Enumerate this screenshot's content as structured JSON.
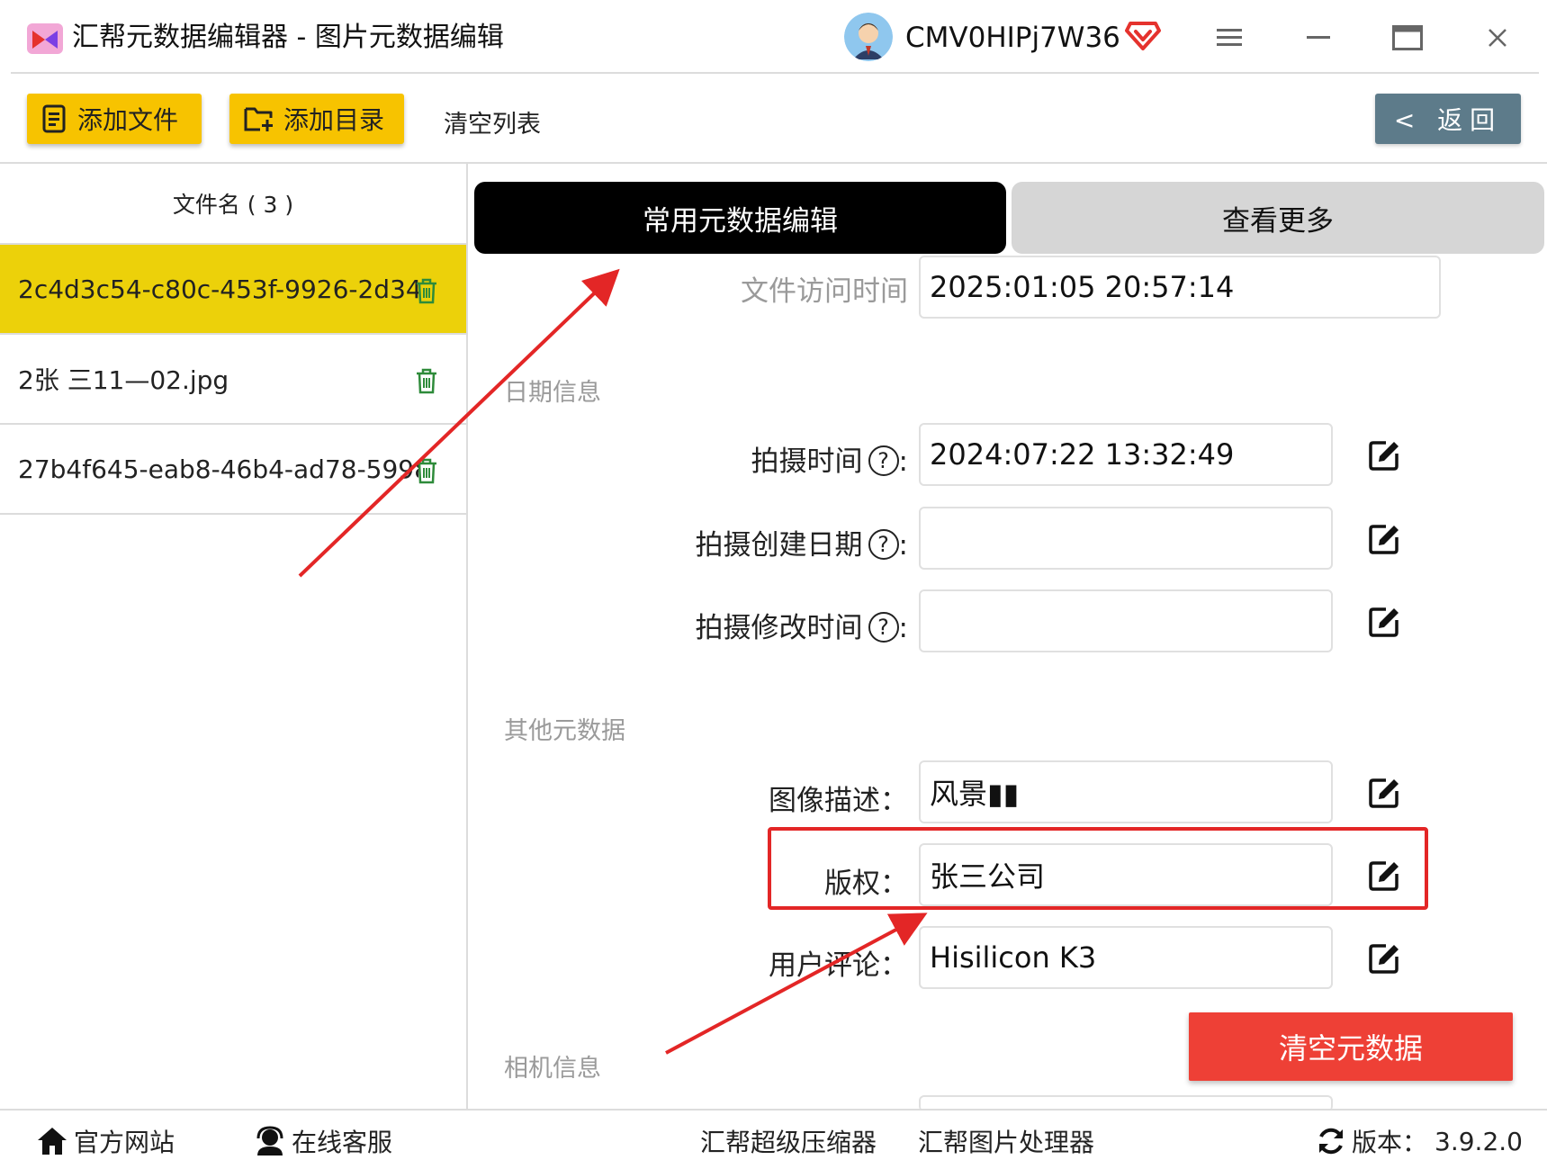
{
  "titlebar": {
    "title": "汇帮元数据编辑器 - 图片元数据编辑",
    "username": "CMV0HIPj7W36",
    "brand_color": "#e5322d",
    "icons": [
      "app-logo-icon",
      "avatar",
      "vip-diamond-icon",
      "menu-icon",
      "minimize-icon",
      "maximize-icon",
      "close-icon"
    ]
  },
  "toolbar": {
    "add_file_label": "添加文件",
    "add_dir_label": "添加目录",
    "clear_list_label": "清空列表",
    "back_label": "< 返回",
    "accent_color": "#f7c300"
  },
  "filelist": {
    "header": "文件名 ( 3 )",
    "files": [
      {
        "name": "2c4d3c54-c80c-453f-9926-2d34...",
        "selected": true
      },
      {
        "name": "2张 三11—02.jpg",
        "selected": false
      },
      {
        "name": "27b4f645-eab8-46b4-ad78-5998...",
        "selected": false
      }
    ]
  },
  "tabs": {
    "common": "常用元数据编辑",
    "more": "查看更多"
  },
  "fields": {
    "access_time": {
      "label": "文件访问时间",
      "value": "2025:01:05 20:57:14"
    },
    "date_section": "日期信息",
    "shoot_time": {
      "label": "拍摄时间",
      "value": "2024:07:22 13:32:49"
    },
    "shoot_create_date": {
      "label": "拍摄创建日期",
      "value": ""
    },
    "shoot_modify_time": {
      "label": "拍摄修改时间",
      "value": ""
    },
    "other_section": "其他元数据",
    "image_desc": {
      "label": "图像描述：",
      "value": "风景▮▮"
    },
    "copyright": {
      "label": "版权：",
      "value": "张三公司"
    },
    "user_comment": {
      "label": "用户评论：",
      "value": "Hisilicon K3"
    },
    "camera_section": "相机信息"
  },
  "actions": {
    "clear_metadata": "清空元数据",
    "clear_color": "#ee4036"
  },
  "footer": {
    "website": "官方网站",
    "support": "在线客服",
    "compressor": "汇帮超级压缩器",
    "image_processor": "汇帮图片处理器",
    "version_label": "版本：",
    "version": "3.9.2.0"
  }
}
